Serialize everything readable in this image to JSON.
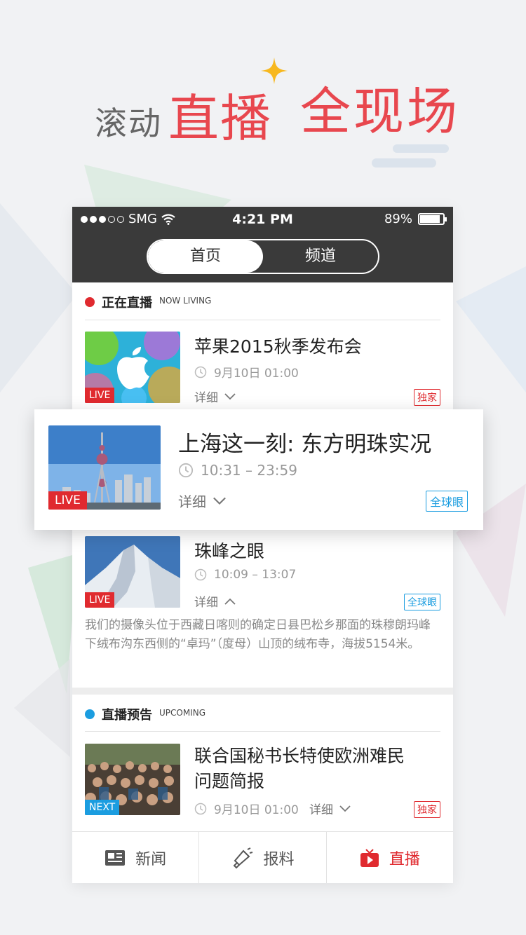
{
  "promo": {
    "small": "滚动",
    "big1": "直播",
    "big2": "全现场"
  },
  "status_bar": {
    "carrier": "SMG",
    "time": "4:21 PM",
    "battery": "89%",
    "battery_level": 0.89
  },
  "segment": {
    "tab1": "首页",
    "tab2": "频道"
  },
  "live_section": {
    "title": "正在直播",
    "subtitle": "NOW LIVING",
    "dot_color": "#e02a2f"
  },
  "items": [
    {
      "title": "苹果2015秋季发布会",
      "time": "9月10日 01:00",
      "detail": "详细",
      "badge": "LIVE",
      "tag": "独家"
    },
    {
      "title": "上海这一刻: 东方明珠实况",
      "time": "10:31 – 23:59",
      "detail": "详细",
      "badge": "LIVE",
      "tag": "全球眼"
    },
    {
      "title": "珠峰之眼",
      "time": "10:09 – 13:07",
      "detail": "详细",
      "badge": "LIVE",
      "tag": "全球眼",
      "description": "我们的摄像头位于西藏日喀则的确定日县巴松乡那面的珠穆朗玛峰下绒布沟东西侧的“卓玛”（度母）山顶的绒布寺，海拔5154米。"
    }
  ],
  "upcoming_section": {
    "title": "直播预告",
    "subtitle": "UPCOMING",
    "dot_color": "#1b9de0"
  },
  "upcoming_item": {
    "title_line1": "联合国秘书长特使欧洲难民",
    "title_line2": "问题简报",
    "time": "9月10日 01:00",
    "detail": "详细",
    "badge": "NEXT",
    "tag": "独家"
  },
  "tabbar": {
    "news": "新闻",
    "report": "报料",
    "live": "直播",
    "active_color": "#e02a2f"
  },
  "icons": {
    "news": "newspaper-icon",
    "report": "megaphone-icon",
    "live": "tv-play-icon",
    "clock": "clock-icon",
    "chevron": "chevron-icon",
    "wifi": "wifi-icon"
  }
}
